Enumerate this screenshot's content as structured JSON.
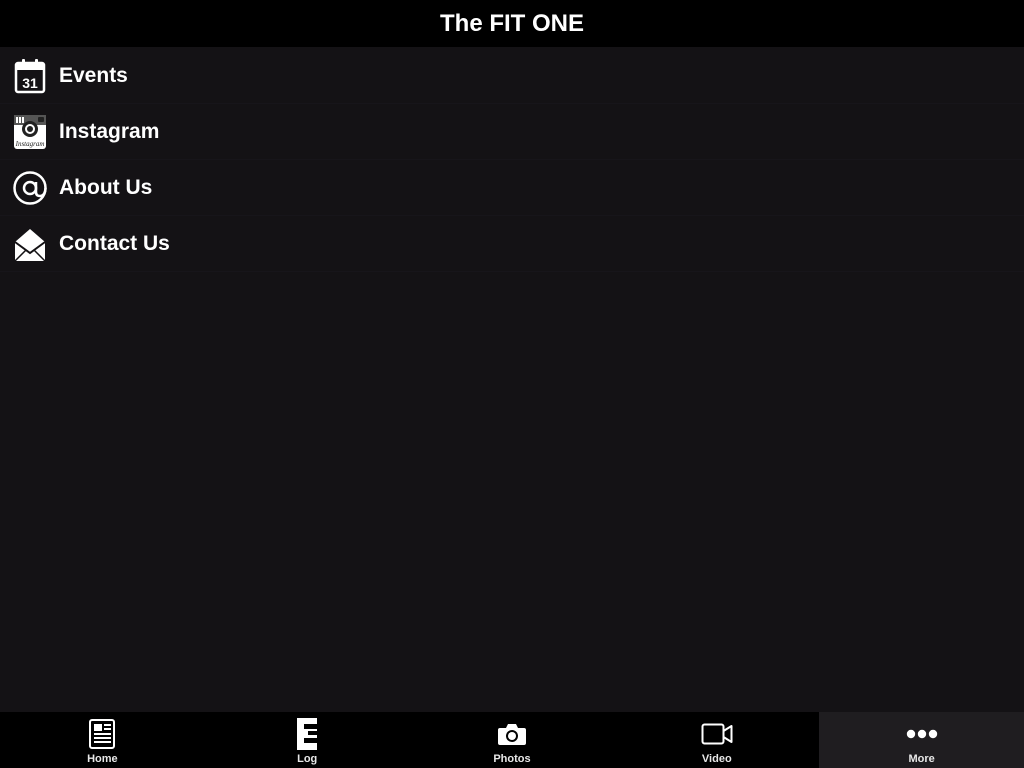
{
  "header": {
    "title": "The FIT ONE"
  },
  "menu": {
    "items": [
      {
        "label": "Events",
        "icon": "calendar-icon",
        "calendar_day": "31"
      },
      {
        "label": "Instagram",
        "icon": "instagram-icon",
        "icon_text": "Instagram"
      },
      {
        "label": "About Us",
        "icon": "at-sign-icon"
      },
      {
        "label": "Contact Us",
        "icon": "envelope-icon"
      }
    ]
  },
  "tabbar": {
    "active": "More",
    "tabs": [
      {
        "label": "Home",
        "icon": "newspaper-icon"
      },
      {
        "label": "Log",
        "icon": "blog-e-icon"
      },
      {
        "label": "Photos",
        "icon": "camera-icon"
      },
      {
        "label": "Video",
        "icon": "video-camera-icon"
      },
      {
        "label": "More",
        "icon": "more-dots-icon"
      }
    ]
  },
  "colors": {
    "background": "#141215",
    "header_background": "#000000",
    "tabbar_background": "#000000",
    "active_tab_background": "#1f1d20",
    "text": "#ffffff"
  }
}
